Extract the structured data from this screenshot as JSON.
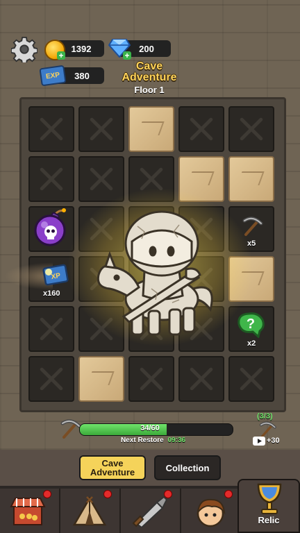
{
  "header": {
    "coins": "1392",
    "gems": "200",
    "exp_label": "EXP",
    "exp": "380",
    "title_line1": "Cave",
    "title_line2": "Adventure",
    "floor": "Floor 1"
  },
  "board": {
    "items": {
      "pickaxe_count": "x5",
      "chest_count": "x160",
      "question_count": "x2"
    }
  },
  "energy": {
    "value": "34/60",
    "fraction": 0.567,
    "restore_label": "Next Restore",
    "restore_time": "09:36",
    "ad_count": "(3/3)",
    "ad_bonus": "+30"
  },
  "tabs": {
    "cave_adventure_line1": "Cave",
    "cave_adventure_line2": "Adventure",
    "collection": "Collection"
  },
  "nav": {
    "relic": "Relic"
  },
  "colors": {
    "accent_yellow": "#ffd35a",
    "energy_green": "#4cc34a",
    "notification_red": "#e32b2b"
  }
}
